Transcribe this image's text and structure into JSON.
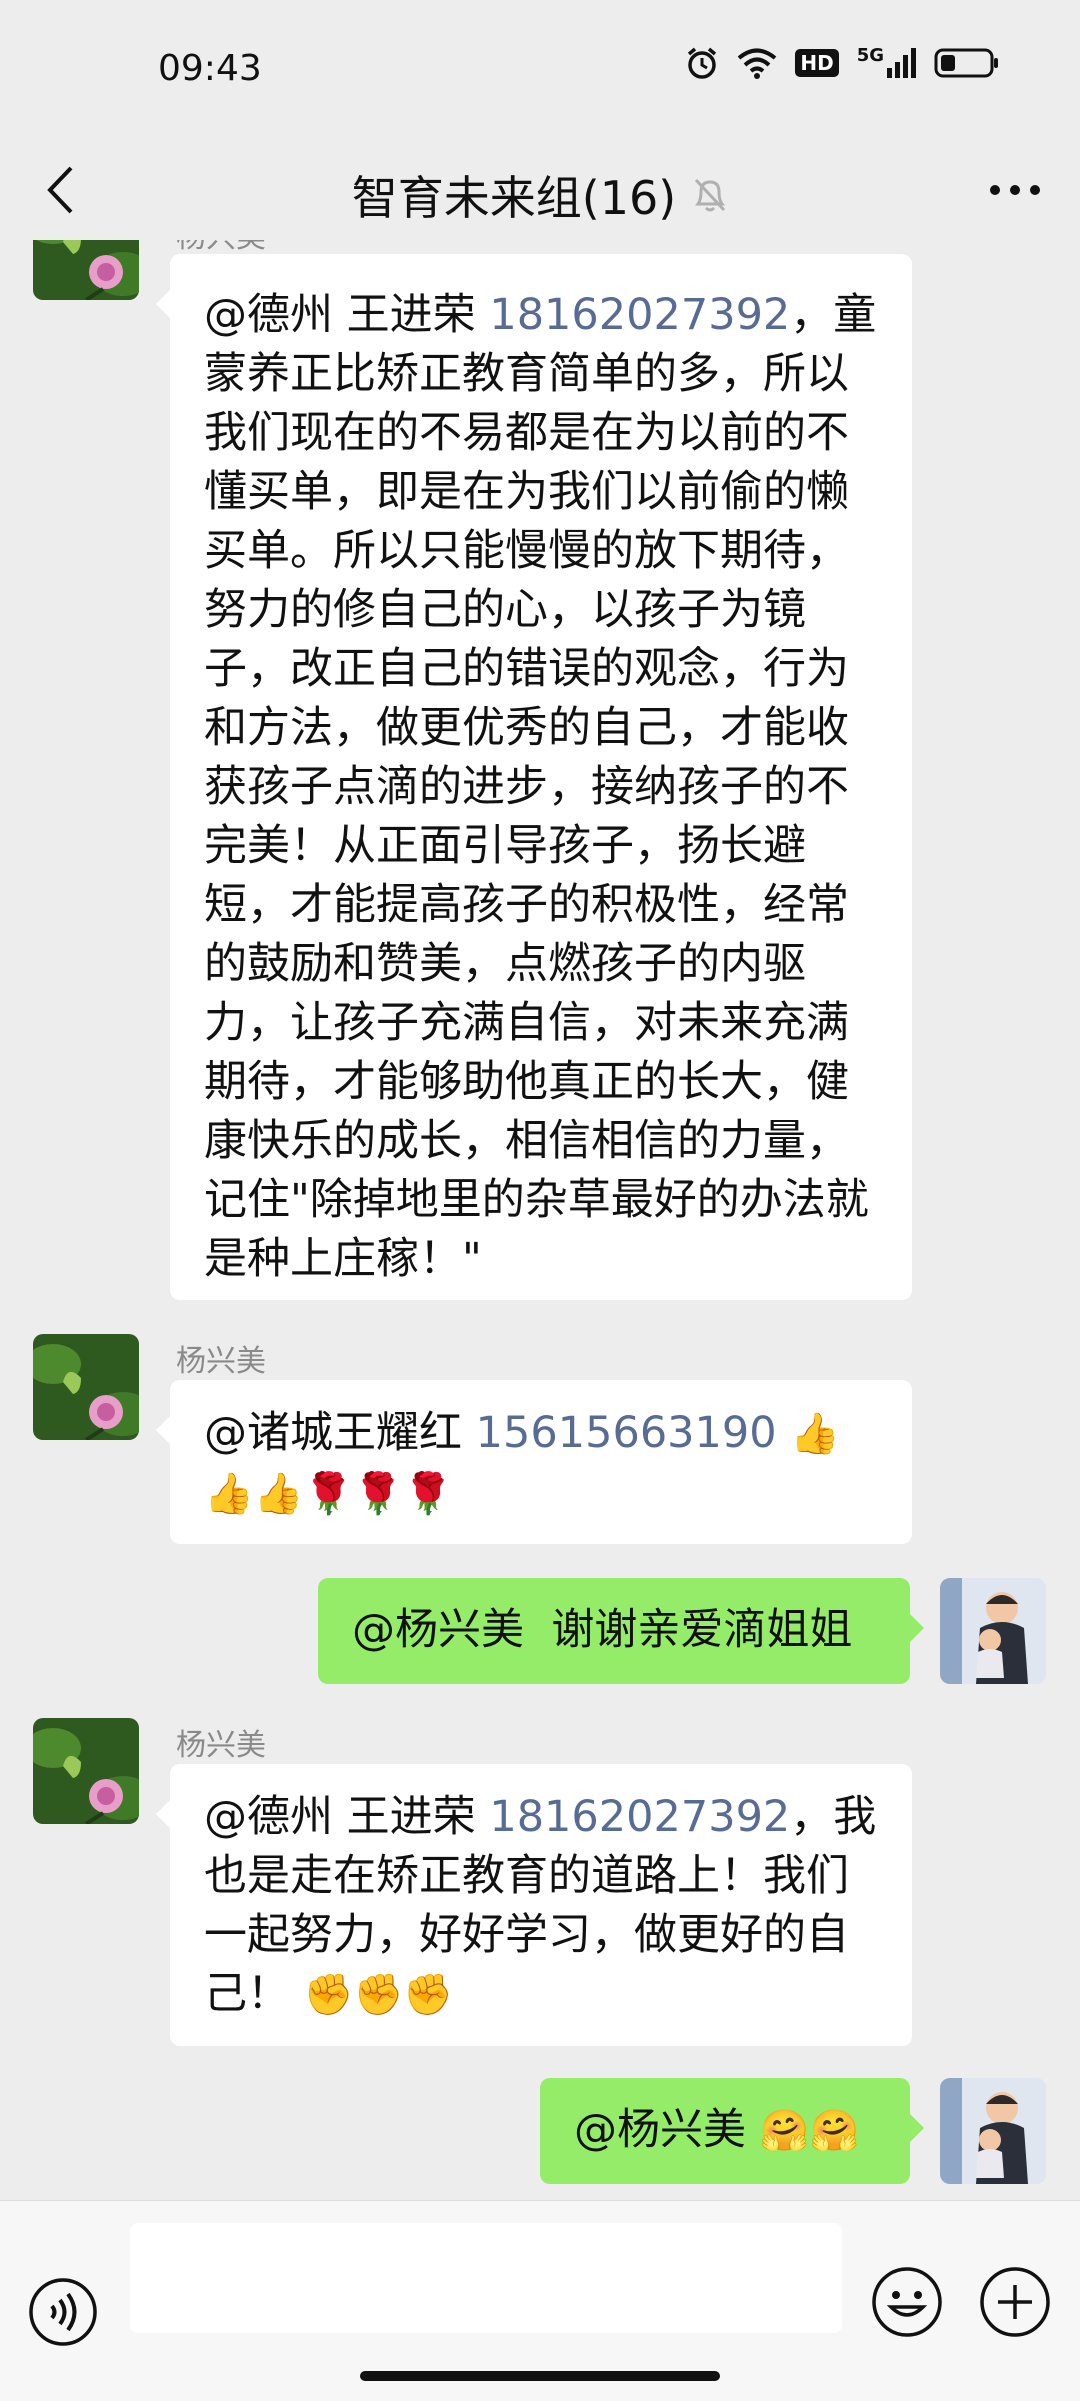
{
  "status_bar": {
    "time": "09:43",
    "hd": "HD",
    "network": "5G"
  },
  "nav": {
    "title": "智育未来组(16)",
    "icons": {
      "back": "chevron-left-icon",
      "muted": "bell-off-icon",
      "more": "more-dots-icon"
    }
  },
  "messages": [
    {
      "side": "in",
      "sender": "杨兴美",
      "mention": "@德州 王进荣",
      "phone": "18162027392",
      "text": "，童蒙养正比矫正教育简单的多，所以我们现在的不易都是在为以前的不懂买单，即是在为我们以前偷的懒买单。所以只能慢慢的放下期待，努力的修自己的心，以孩子为镜子，改正自己的错误的观念，行为和方法，做更优秀的自己，才能收获孩子点滴的进步，接纳孩子的不完美！从正面引导孩子，扬长避短，才能提高孩子的积极性，经常的鼓励和赞美，点燃孩子的内驱力，让孩子充满自信，对未来充满期待，才能够助他真正的长大，健康快乐的成长，相信相信的力量，记住\"除掉地里的杂草最好的办法就是种上庄稼！\""
    },
    {
      "side": "in",
      "sender": "杨兴美",
      "mention": "@诸城王耀红",
      "phone": "15615663190",
      "emoji": "👍👍👍🌹🌹🌹"
    },
    {
      "side": "out",
      "text": "@杨兴美  谢谢亲爱滴姐姐"
    },
    {
      "side": "in",
      "sender": "杨兴美",
      "mention": "@德州 王进荣",
      "phone": "18162027392",
      "text": "，我也是走在矫正教育的道路上！我们一起努力，好好学习，做更好的自己！",
      "emoji": "✊✊✊"
    },
    {
      "side": "out",
      "text": "@杨兴美 ",
      "emoji": "🤗🤗"
    }
  ],
  "input_bar": {
    "placeholder": "",
    "icons": {
      "voice": "voice-icon",
      "emoji": "emoji-face-icon",
      "plus": "plus-icon"
    }
  },
  "colors": {
    "background": "#ededed",
    "incoming_bubble": "#ffffff",
    "outgoing_bubble": "#95ec69",
    "phone_link": "#576b95",
    "sender_name": "#8a8a8a"
  }
}
